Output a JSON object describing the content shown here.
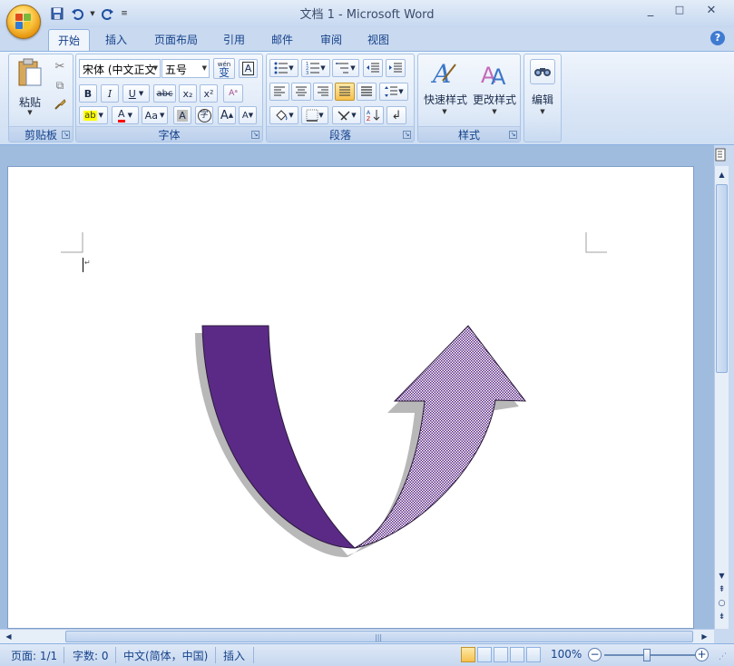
{
  "window": {
    "title": "文档 1 - Microsoft Word",
    "minimize": "_",
    "maximize": "□",
    "close": "✕"
  },
  "qat": {
    "icons": [
      "save-icon",
      "undo-icon",
      "redo-icon",
      "customize-icon"
    ]
  },
  "tabs": [
    {
      "label": "开始",
      "active": true
    },
    {
      "label": "插入"
    },
    {
      "label": "页面布局"
    },
    {
      "label": "引用"
    },
    {
      "label": "邮件"
    },
    {
      "label": "审阅"
    },
    {
      "label": "视图"
    }
  ],
  "help_label": "?",
  "clipboard": {
    "group_label": "剪贴板",
    "paste_label": "粘贴"
  },
  "font": {
    "group_label": "字体",
    "font_name": "宋体 (中文正文",
    "font_size": "五号",
    "wen_label": "wén",
    "wen_char": "变",
    "border_char": "A",
    "bold": "B",
    "italic": "I",
    "underline": "U",
    "strike": "abc",
    "subscript": "x₂",
    "superscript": "x²",
    "font_color": "A",
    "change_case": "Aa",
    "char_shading": "A",
    "enclose_char": "字",
    "grow_font": "A",
    "shrink_font": "A"
  },
  "paragraph": {
    "group_label": "段落"
  },
  "styles": {
    "group_label": "样式",
    "quick_styles": "快速样式",
    "change_styles": "更改样式"
  },
  "editing": {
    "label": "编辑"
  },
  "status": {
    "page": "页面: 1/1",
    "words": "字数: 0",
    "language": "中文(简体，中国)",
    "mode": "插入",
    "zoom": "100%"
  },
  "colors": {
    "arrow_dark": "#5b2a86",
    "arrow_light": "#c9b3dd",
    "shadow": "#b8b8b8",
    "highlight": "#ffff00",
    "font_color": "#ff0000"
  }
}
